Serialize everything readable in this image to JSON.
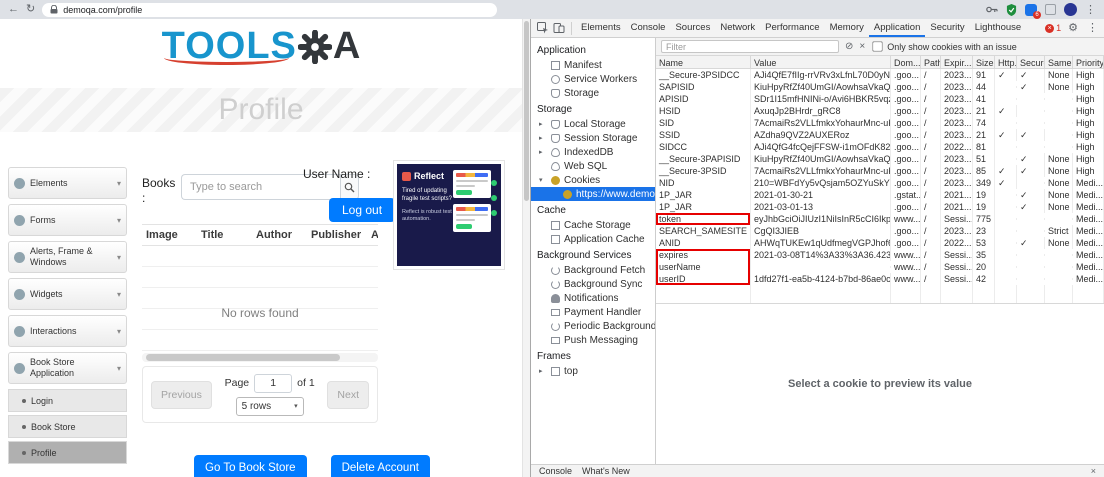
{
  "browser": {
    "url": "demoqa.com/profile",
    "extension_badge": "6"
  },
  "page": {
    "logo_tools": "TOOLS",
    "logo_a": "A",
    "banner_title": "Profile",
    "sidebar": [
      {
        "label": "Elements"
      },
      {
        "label": "Forms"
      },
      {
        "label": "Alerts, Frame & Windows"
      },
      {
        "label": "Widgets"
      },
      {
        "label": "Interactions"
      },
      {
        "label": "Book Store Application",
        "children": [
          {
            "label": "Login",
            "selected": false
          },
          {
            "label": "Book Store",
            "selected": false
          },
          {
            "label": "Profile",
            "selected": true
          }
        ]
      }
    ],
    "books_label": "Books :",
    "search_placeholder": "Type to search",
    "username_label": "User Name :",
    "logout_label": "Log out",
    "table_headers": [
      "Image",
      "Title",
      "Author",
      "Publisher",
      "Action"
    ],
    "no_rows": "No rows found",
    "pagination": {
      "previous": "Previous",
      "page_label": "Page",
      "page_value": "1",
      "of_label": "of 1",
      "rows_per_page": "5 rows",
      "next": "Next"
    },
    "go_to_book_store": "Go To Book Store",
    "delete_account": "Delete Account",
    "ad": {
      "brand": "Reflect",
      "headline": "Tired of updating fragile test scripts?",
      "body": "Reflect is robust test automation."
    }
  },
  "devtools": {
    "tabs": [
      "Elements",
      "Console",
      "Sources",
      "Network",
      "Performance",
      "Memory",
      "Application",
      "Security",
      "Lighthouse"
    ],
    "selected_tab": "Application",
    "error_count": "1",
    "filter_placeholder": "Filter",
    "issue_filter_label": "Only show cookies with an issue",
    "tree": [
      {
        "section": "Application",
        "items": [
          {
            "label": "Manifest",
            "icon": "manifest-icon"
          },
          {
            "label": "Service Workers",
            "icon": "service-worker-icon"
          },
          {
            "label": "Storage",
            "icon": "storage-icon"
          }
        ]
      },
      {
        "section": "Storage",
        "items": [
          {
            "label": "Local Storage",
            "icon": "storage-icon",
            "expander": "closed"
          },
          {
            "label": "Session Storage",
            "icon": "storage-icon",
            "expander": "closed"
          },
          {
            "label": "IndexedDB",
            "icon": "database-icon",
            "expander": "closed"
          },
          {
            "label": "Web SQL",
            "icon": "database-icon"
          },
          {
            "label": "Cookies",
            "icon": "cookie-icon",
            "expander": "open",
            "children": [
              {
                "label": "https://www.demoqa.com",
                "icon": "cookie-icon",
                "selected": true
              }
            ]
          }
        ]
      },
      {
        "section": "Cache",
        "items": [
          {
            "label": "Cache Storage",
            "icon": "cache-icon"
          },
          {
            "label": "Application Cache",
            "icon": "cache-icon"
          }
        ]
      },
      {
        "section": "Background Services",
        "items": [
          {
            "label": "Background Fetch",
            "icon": "sync-icon"
          },
          {
            "label": "Background Sync",
            "icon": "sync-icon"
          },
          {
            "label": "Notifications",
            "icon": "bell-icon"
          },
          {
            "label": "Payment Handler",
            "icon": "payment-icon"
          },
          {
            "label": "Periodic Background Sync",
            "icon": "sync-icon"
          },
          {
            "label": "Push Messaging",
            "icon": "message-icon"
          }
        ]
      },
      {
        "section": "Frames",
        "items": [
          {
            "label": "top",
            "icon": "frame-icon",
            "expander": "closed"
          }
        ]
      }
    ],
    "cookies": {
      "headers": [
        "Name",
        "Value",
        "Dom...",
        "Path",
        "Expir...",
        "Size",
        "Http...",
        "Secure",
        "Same...",
        "Priority"
      ],
      "rows": [
        {
          "name": "__Secure-3PSIDCC",
          "value": "AJi4QfE7fIIg-rrVRv3xLfnL70D0yN8-Gsg...",
          "domain": ".goo...",
          "path": "/",
          "expires": "2023...",
          "size": "91",
          "http": "✓",
          "secure": "✓",
          "samesite": "None",
          "priority": "High"
        },
        {
          "name": "SAPISID",
          "value": "KiuHpyRfZf40UmGI/AowhsaVkaQymWQ...",
          "domain": ".goo...",
          "path": "/",
          "expires": "2023...",
          "size": "44",
          "http": "",
          "secure": "✓",
          "samesite": "None",
          "priority": "High"
        },
        {
          "name": "APISID",
          "value": "SDr1I15mfHNINi-o/Avi6HBKR5vqz5nIVX",
          "domain": ".goo...",
          "path": "/",
          "expires": "2023...",
          "size": "41",
          "http": "",
          "secure": "",
          "samesite": "",
          "priority": "High"
        },
        {
          "name": "HSID",
          "value": "AxuqJp2BHrdr_gRC8",
          "domain": ".goo...",
          "path": "/",
          "expires": "2023...",
          "size": "21",
          "http": "✓",
          "secure": "",
          "samesite": "",
          "priority": "High"
        },
        {
          "name": "SID",
          "value": "7AcmaiRs2VLLfmkxYohaurMnc-uKlUeRD...",
          "domain": ".goo...",
          "path": "/",
          "expires": "2023...",
          "size": "74",
          "http": "",
          "secure": "",
          "samesite": "",
          "priority": "High"
        },
        {
          "name": "SSID",
          "value": "AZdha9QVZ2AUXERoz",
          "domain": ".goo...",
          "path": "/",
          "expires": "2023...",
          "size": "21",
          "http": "✓",
          "secure": "✓",
          "samesite": "",
          "priority": "High"
        },
        {
          "name": "SIDCC",
          "value": "AJi4QfG4fcQejFFSW-i1mOFdK82UznOG...",
          "domain": ".goo...",
          "path": "/",
          "expires": "2022...",
          "size": "81",
          "http": "",
          "secure": "",
          "samesite": "",
          "priority": "High"
        },
        {
          "name": "__Secure-3PAPISID",
          "value": "KiuHpyRfZf40UmGI/AowhsaVkaQymWQ...",
          "domain": ".goo...",
          "path": "/",
          "expires": "2023...",
          "size": "51",
          "http": "",
          "secure": "✓",
          "samesite": "None",
          "priority": "High"
        },
        {
          "name": "__Secure-3PSID",
          "value": "7AcmaiRs2VLLfmkxYohaurMnc-uKlUeRD...",
          "domain": ".goo...",
          "path": "/",
          "expires": "2023...",
          "size": "85",
          "http": "✓",
          "secure": "✓",
          "samesite": "None",
          "priority": "High"
        },
        {
          "name": "NID",
          "value": "210=WBFdYy5vQsjam5OZYuSkYGoKufL...",
          "domain": ".goo...",
          "path": "/",
          "expires": "2023...",
          "size": "349",
          "http": "✓",
          "secure": "",
          "samesite": "None",
          "priority": "Medi..."
        },
        {
          "name": "1P_JAR",
          "value": "2021-01-30-21",
          "domain": ".gstat...",
          "path": "/",
          "expires": "2021...",
          "size": "19",
          "http": "",
          "secure": "✓",
          "samesite": "None",
          "priority": "Medi..."
        },
        {
          "name": "1P_JAR",
          "value": "2021-03-01-13",
          "domain": ".goo...",
          "path": "/",
          "expires": "2021...",
          "size": "19",
          "http": "",
          "secure": "✓",
          "samesite": "None",
          "priority": "Medi..."
        },
        {
          "name": "token",
          "value": "eyJhbGciOiJIUzI1NiIsInR5cCI6IkpXVCJ9.e...",
          "domain": "www...",
          "path": "/",
          "expires": "Sessi...",
          "size": "775",
          "http": "",
          "secure": "",
          "samesite": "",
          "priority": "Medi...",
          "hl": "single"
        },
        {
          "name": "SEARCH_SAMESITE",
          "value": "CgQI3JIEB",
          "domain": ".goo...",
          "path": "/",
          "expires": "2023...",
          "size": "23",
          "http": "",
          "secure": "",
          "samesite": "Strict",
          "priority": "Medi..."
        },
        {
          "name": "ANID",
          "value": "AHWqTUKEw1qUdfmegVGPJhof67tHcvE...",
          "domain": ".goo...",
          "path": "/",
          "expires": "2022...",
          "size": "53",
          "http": "",
          "secure": "✓",
          "samesite": "None",
          "priority": "Medi..."
        },
        {
          "name": "expires",
          "value": "2021-03-08T14%3A33%3A36.423Z",
          "domain": "www...",
          "path": "/",
          "expires": "Sessi...",
          "size": "35",
          "http": "",
          "secure": "",
          "samesite": "",
          "priority": "Medi...",
          "hl": "start"
        },
        {
          "name": "userName",
          "value": "",
          "domain": "www...",
          "path": "/",
          "expires": "Sessi...",
          "size": "20",
          "http": "",
          "secure": "",
          "samesite": "",
          "priority": "Medi...",
          "hl": "mid"
        },
        {
          "name": "userID",
          "value": "1dfd27f1-ea5b-4124-b7bd-86ae0c19977e",
          "domain": "www...",
          "path": "/",
          "expires": "Sessi...",
          "size": "42",
          "http": "",
          "secure": "",
          "samesite": "",
          "priority": "Medi...",
          "hl": "end"
        }
      ]
    },
    "preview_hint": "Select a cookie to preview its value",
    "drawer": {
      "console_label": "Console",
      "whats_new_label": "What's New"
    }
  }
}
